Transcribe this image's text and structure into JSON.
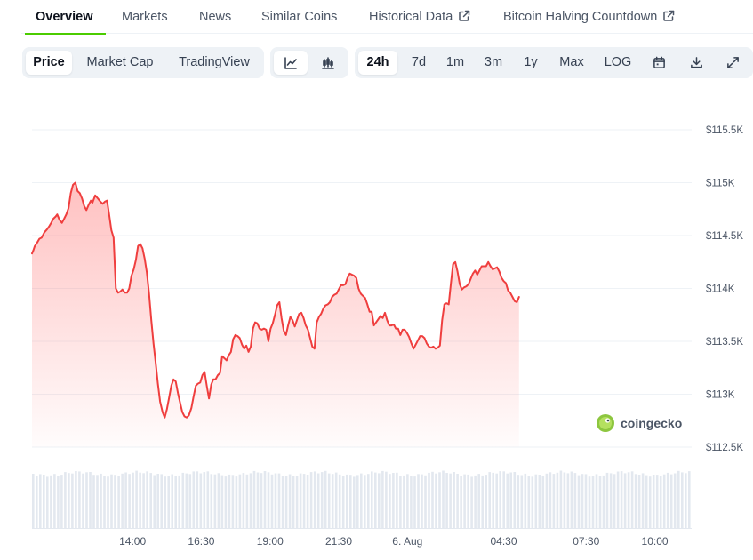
{
  "nav": {
    "tabs": [
      {
        "label": "Overview",
        "active": true,
        "external": false
      },
      {
        "label": "Markets",
        "active": false,
        "external": false
      },
      {
        "label": "News",
        "active": false,
        "external": false
      },
      {
        "label": "Similar Coins",
        "active": false,
        "external": false
      },
      {
        "label": "Historical Data",
        "active": false,
        "external": true
      },
      {
        "label": "Bitcoin Halving Countdown",
        "active": false,
        "external": true
      }
    ]
  },
  "toolbar": {
    "view_tabs": [
      {
        "label": "Price",
        "active": true
      },
      {
        "label": "Market Cap",
        "active": false
      },
      {
        "label": "TradingView",
        "active": false
      }
    ],
    "chart_style_icons": [
      {
        "icon": "line-chart-icon",
        "active": true
      },
      {
        "icon": "candlestick-chart-icon",
        "active": false
      }
    ],
    "ranges": [
      {
        "label": "24h",
        "active": true
      },
      {
        "label": "7d",
        "active": false
      },
      {
        "label": "1m",
        "active": false
      },
      {
        "label": "3m",
        "active": false
      },
      {
        "label": "1y",
        "active": false
      },
      {
        "label": "Max",
        "active": false
      },
      {
        "label": "LOG",
        "active": false
      }
    ],
    "tool_icons": [
      "calendar-icon",
      "download-icon",
      "fullscreen-icon"
    ]
  },
  "watermark": {
    "text": "coingecko",
    "icon": "coingecko-logo-icon"
  },
  "colors": {
    "accent": "#4bcc00",
    "line": "#ef3e3e",
    "area": "#ff6b6b",
    "volume": "#e3e8ef",
    "grid": "#eef2f6"
  },
  "chart_data": {
    "type": "line",
    "x_tick_labels": [
      "14:00",
      "16:30",
      "19:00",
      "21:30",
      "6. Aug",
      "04:30",
      "07:30",
      "10:00"
    ],
    "y_tick_labels": [
      "$112.5K",
      "$113K",
      "$113.5K",
      "$114K",
      "$114.5K",
      "$115K",
      "$115.5K"
    ],
    "ylim": [
      112500,
      115500
    ],
    "xlim_hours": [
      0,
      24
    ],
    "x_tick_hours": [
      3.66,
      6.16,
      8.66,
      11.16,
      13.66,
      17.16,
      20.16,
      22.66
    ],
    "grid": true,
    "series": [
      {
        "values": [
          [
            0.0,
            114330
          ],
          [
            0.05,
            114360
          ],
          [
            0.1,
            114400
          ],
          [
            0.18,
            114430
          ],
          [
            0.27,
            114470
          ],
          [
            0.35,
            114480
          ],
          [
            0.45,
            114530
          ],
          [
            0.55,
            114560
          ],
          [
            0.63,
            114590
          ],
          [
            0.7,
            114620
          ],
          [
            0.78,
            114660
          ],
          [
            0.86,
            114680
          ],
          [
            0.92,
            114700
          ],
          [
            1.0,
            114650
          ],
          [
            1.09,
            114620
          ],
          [
            1.17,
            114660
          ],
          [
            1.25,
            114700
          ],
          [
            1.33,
            114760
          ],
          [
            1.41,
            114900
          ],
          [
            1.49,
            114980
          ],
          [
            1.58,
            115000
          ],
          [
            1.66,
            114920
          ],
          [
            1.74,
            114900
          ],
          [
            1.82,
            114850
          ],
          [
            1.9,
            114780
          ],
          [
            1.98,
            114740
          ],
          [
            2.06,
            114790
          ],
          [
            2.14,
            114830
          ],
          [
            2.2,
            114810
          ],
          [
            2.3,
            114880
          ],
          [
            2.4,
            114850
          ],
          [
            2.49,
            114820
          ],
          [
            2.57,
            114800
          ],
          [
            2.65,
            114820
          ],
          [
            2.73,
            114830
          ],
          [
            2.8,
            114710
          ],
          [
            2.89,
            114550
          ],
          [
            2.97,
            114480
          ],
          [
            3.05,
            114000
          ],
          [
            3.13,
            113960
          ],
          [
            3.21,
            113970
          ],
          [
            3.29,
            113990
          ],
          [
            3.38,
            113960
          ],
          [
            3.46,
            113960
          ],
          [
            3.54,
            114000
          ],
          [
            3.62,
            114120
          ],
          [
            3.7,
            114180
          ],
          [
            3.78,
            114270
          ],
          [
            3.86,
            114400
          ],
          [
            3.94,
            114420
          ],
          [
            4.02,
            114380
          ],
          [
            4.1,
            114280
          ],
          [
            4.18,
            114150
          ],
          [
            4.26,
            113950
          ],
          [
            4.34,
            113700
          ],
          [
            4.42,
            113480
          ],
          [
            4.5,
            113300
          ],
          [
            4.58,
            113100
          ],
          [
            4.66,
            112930
          ],
          [
            4.75,
            112830
          ],
          [
            4.83,
            112780
          ],
          [
            4.91,
            112860
          ],
          [
            4.99,
            112970
          ],
          [
            5.07,
            113080
          ],
          [
            5.15,
            113140
          ],
          [
            5.23,
            113120
          ],
          [
            5.31,
            113010
          ],
          [
            5.39,
            112920
          ],
          [
            5.47,
            112830
          ],
          [
            5.55,
            112790
          ],
          [
            5.63,
            112780
          ],
          [
            5.71,
            112800
          ],
          [
            5.8,
            112870
          ],
          [
            5.88,
            112980
          ],
          [
            5.96,
            113080
          ],
          [
            6.04,
            113100
          ],
          [
            6.12,
            113110
          ],
          [
            6.2,
            113180
          ],
          [
            6.28,
            113210
          ],
          [
            6.36,
            113080
          ],
          [
            6.44,
            112960
          ],
          [
            6.52,
            113090
          ],
          [
            6.6,
            113140
          ],
          [
            6.68,
            113140
          ],
          [
            6.76,
            113180
          ],
          [
            6.84,
            113200
          ],
          [
            6.92,
            113360
          ],
          [
            7.0,
            113340
          ],
          [
            7.08,
            113320
          ],
          [
            7.16,
            113370
          ],
          [
            7.24,
            113400
          ],
          [
            7.32,
            113520
          ],
          [
            7.4,
            113560
          ],
          [
            7.48,
            113550
          ],
          [
            7.56,
            113530
          ],
          [
            7.64,
            113470
          ],
          [
            7.72,
            113430
          ],
          [
            7.8,
            113460
          ],
          [
            7.88,
            113400
          ],
          [
            7.96,
            113450
          ],
          [
            8.04,
            113620
          ],
          [
            8.12,
            113680
          ],
          [
            8.2,
            113670
          ],
          [
            8.28,
            113620
          ],
          [
            8.36,
            113610
          ],
          [
            8.44,
            113620
          ],
          [
            8.52,
            113610
          ],
          [
            8.6,
            113500
          ],
          [
            8.68,
            113620
          ],
          [
            8.76,
            113670
          ],
          [
            8.84,
            113750
          ],
          [
            8.92,
            113840
          ],
          [
            9.0,
            113870
          ],
          [
            9.08,
            113720
          ],
          [
            9.16,
            113600
          ],
          [
            9.24,
            113560
          ],
          [
            9.32,
            113650
          ],
          [
            9.4,
            113730
          ],
          [
            9.48,
            113700
          ],
          [
            9.56,
            113640
          ],
          [
            9.64,
            113700
          ],
          [
            9.72,
            113760
          ],
          [
            9.8,
            113770
          ],
          [
            9.88,
            113720
          ],
          [
            9.96,
            113650
          ],
          [
            10.04,
            113610
          ],
          [
            10.12,
            113530
          ],
          [
            10.2,
            113450
          ],
          [
            10.28,
            113430
          ],
          [
            10.36,
            113680
          ],
          [
            10.44,
            113730
          ],
          [
            10.52,
            113760
          ],
          [
            10.6,
            113810
          ],
          [
            10.68,
            113840
          ],
          [
            10.76,
            113850
          ],
          [
            10.84,
            113870
          ],
          [
            10.92,
            113920
          ],
          [
            11.0,
            113940
          ],
          [
            11.08,
            113950
          ],
          [
            11.16,
            113990
          ],
          [
            11.24,
            114030
          ],
          [
            11.32,
            114030
          ],
          [
            11.4,
            114040
          ],
          [
            11.48,
            114100
          ],
          [
            11.56,
            114140
          ],
          [
            11.64,
            114130
          ],
          [
            11.72,
            114120
          ],
          [
            11.8,
            114100
          ],
          [
            11.88,
            114000
          ],
          [
            11.96,
            113950
          ],
          [
            12.04,
            113930
          ],
          [
            12.12,
            113910
          ],
          [
            12.2,
            113850
          ],
          [
            12.28,
            113780
          ],
          [
            12.36,
            113780
          ],
          [
            12.44,
            113650
          ],
          [
            12.52,
            113680
          ],
          [
            12.6,
            113710
          ],
          [
            12.68,
            113740
          ],
          [
            12.76,
            113720
          ],
          [
            12.84,
            113770
          ],
          [
            12.92,
            113700
          ],
          [
            13.0,
            113650
          ],
          [
            13.08,
            113650
          ],
          [
            13.16,
            113660
          ],
          [
            13.24,
            113620
          ],
          [
            13.32,
            113620
          ],
          [
            13.4,
            113560
          ],
          [
            13.48,
            113610
          ],
          [
            13.56,
            113610
          ],
          [
            13.64,
            113580
          ],
          [
            13.72,
            113540
          ],
          [
            13.8,
            113480
          ],
          [
            13.88,
            113430
          ],
          [
            13.96,
            113470
          ],
          [
            14.04,
            113510
          ],
          [
            14.12,
            113550
          ],
          [
            14.2,
            113550
          ],
          [
            14.28,
            113530
          ],
          [
            14.36,
            113480
          ],
          [
            14.44,
            113450
          ],
          [
            14.52,
            113440
          ],
          [
            14.6,
            113450
          ],
          [
            14.68,
            113430
          ],
          [
            14.76,
            113440
          ],
          [
            14.84,
            113460
          ],
          [
            14.92,
            113700
          ],
          [
            15.0,
            113850
          ],
          [
            15.08,
            113860
          ],
          [
            15.16,
            113850
          ],
          [
            15.24,
            114050
          ],
          [
            15.32,
            114230
          ],
          [
            15.4,
            114250
          ],
          [
            15.48,
            114160
          ],
          [
            15.56,
            114040
          ],
          [
            15.64,
            113990
          ],
          [
            15.72,
            114010
          ],
          [
            15.8,
            114020
          ],
          [
            15.88,
            114040
          ],
          [
            15.96,
            114090
          ],
          [
            16.04,
            114140
          ],
          [
            16.12,
            114170
          ],
          [
            16.2,
            114130
          ],
          [
            16.28,
            114170
          ],
          [
            16.36,
            114210
          ],
          [
            16.44,
            114210
          ],
          [
            16.52,
            114210
          ],
          [
            16.6,
            114250
          ],
          [
            16.68,
            114210
          ],
          [
            16.76,
            114180
          ],
          [
            16.84,
            114190
          ],
          [
            16.92,
            114200
          ],
          [
            17.0,
            114160
          ],
          [
            17.08,
            114100
          ],
          [
            17.16,
            114070
          ],
          [
            17.24,
            114050
          ],
          [
            17.32,
            113980
          ],
          [
            17.4,
            113960
          ],
          [
            17.48,
            113920
          ],
          [
            17.56,
            113880
          ],
          [
            17.64,
            113870
          ],
          [
            17.72,
            113920
          ]
        ]
      }
    ]
  }
}
